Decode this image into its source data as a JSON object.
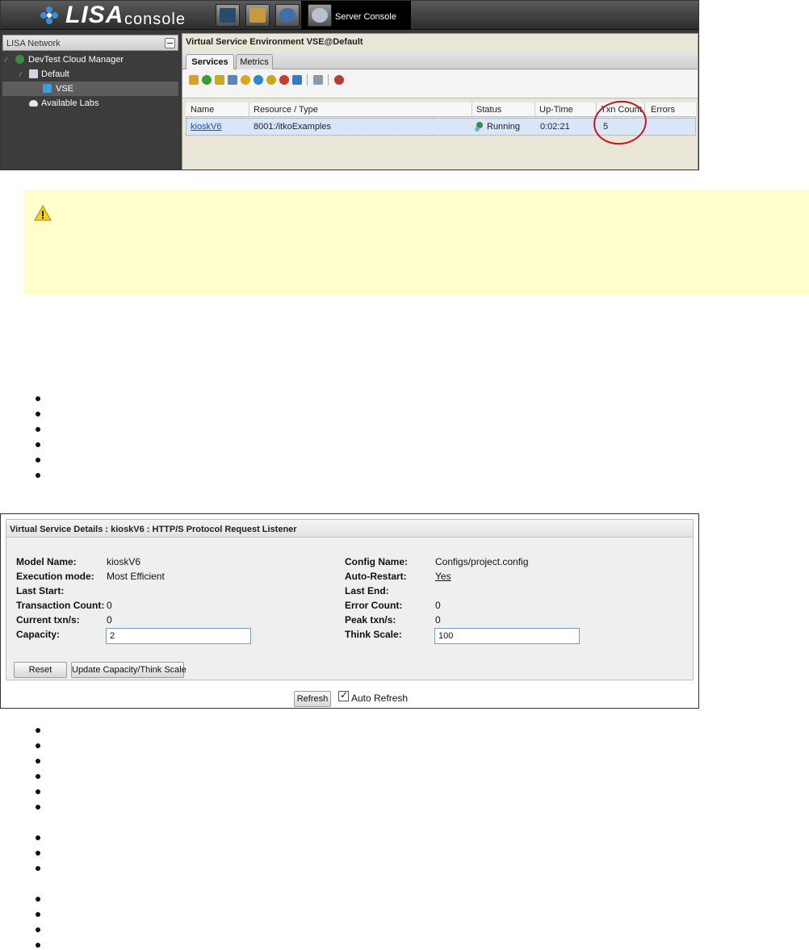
{
  "console": {
    "logo_text": "LISA",
    "logo_sub": "console",
    "active_tab_label": "Server Console",
    "left_panel": {
      "title": "LISA Network",
      "tree": [
        "DevTest Cloud Manager",
        "Default",
        "VSE",
        "Available Labs"
      ]
    },
    "main": {
      "title": "Virtual Service Environment VSE@Default",
      "tabs": [
        "Services",
        "Metrics"
      ],
      "columns": [
        "Name",
        "Resource / Type",
        "Status",
        "Up-Time",
        "Txn Count",
        "Errors"
      ],
      "rows": [
        {
          "name": "kioskV6",
          "resource": "8001:/itkoExamples",
          "status": "Running",
          "uptime": "0:02:21",
          "txn_count": "5",
          "errors": ""
        }
      ]
    },
    "colors": {
      "highlight_circle": "#c4161c",
      "selected_row": "#d9e6f7",
      "warning_bg": "#ffffce"
    }
  },
  "details": {
    "title": "Virtual Service Details : kioskV6 : HTTP/S Protocol Request Listener",
    "left": [
      {
        "label": "Model Name:",
        "value": "kioskV6"
      },
      {
        "label": "Execution mode:",
        "value": "Most Efficient"
      },
      {
        "label": "Last Start:",
        "value": ""
      },
      {
        "label": "Transaction Count:",
        "value": "0"
      },
      {
        "label": "Current txn/s:",
        "value": "0"
      },
      {
        "label": "Capacity:",
        "value": "2"
      }
    ],
    "right": [
      {
        "label": "Config Name:",
        "value": "Configs/project.config"
      },
      {
        "label": "Auto-Restart:",
        "value": "Yes"
      },
      {
        "label": "Last End:",
        "value": ""
      },
      {
        "label": "Error Count:",
        "value": "0"
      },
      {
        "label": "Peak txn/s:",
        "value": "0"
      },
      {
        "label": "Think Scale:",
        "value": "100"
      }
    ],
    "reset_label": "Reset",
    "update_label": "Update Capacity/Think Scale",
    "refresh_label": "Refresh",
    "auto_refresh_label": "Auto Refresh"
  }
}
